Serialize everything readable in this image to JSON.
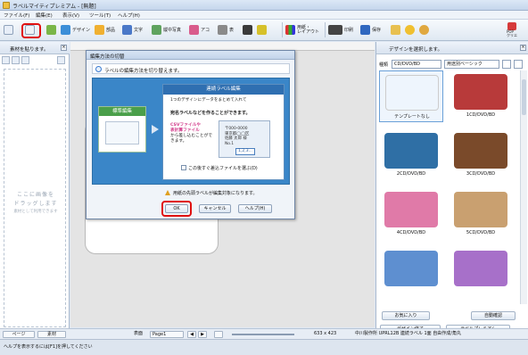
{
  "window": {
    "title": "ラベルマイティプレミアム - [無題]"
  },
  "menu": [
    "ファイル(F)",
    "編集(E)",
    "表示(V)",
    "ツール(T)",
    "ヘルプ(H)"
  ],
  "toolbar": {
    "design": "デザイン",
    "frame": "部品",
    "text": "文字",
    "clip": "縦中写真",
    "art": "アコ",
    "table": "表",
    "layout": "用紙・\nレイアウト",
    "print": "印刷",
    "save": "保存",
    "pop": "POP\nクリエ"
  },
  "left_pane": {
    "header": "素材を貼ります。",
    "drop_line1": "ここに画像を",
    "drop_line2": "ドラッグします",
    "drop_line3": "素材として利用できます"
  },
  "dialog": {
    "title": "編集方法の切替",
    "message": "ラベルの編集方法を切り替えます。",
    "standard_title": "標準編集",
    "multi_title": "連続ラベル編集",
    "multi_desc": "1つのデザインにデータをまとめて入れて",
    "multi_desc2": "宛名ラベルなどを作ることができます。",
    "csv_label": "CSVファイルや",
    "csv_label2": "表計算ファイル",
    "csv_rest": "から差し込むことができます。",
    "doc_lines": [
      "〒000-0000",
      "東京都◯◯区",
      "佐藤 太郎 様",
      "No.1"
    ],
    "seq_label": "1,2,3...",
    "checkbox_label": "この後すぐ差込ファイルを選ぶ(D)",
    "warning": "用紙の先頭ラベルが編集対象になります。",
    "ok": "OK",
    "cancel": "キャンセル",
    "help": "ヘルプ(H)"
  },
  "right_pane": {
    "header": "デザインを選択します。",
    "kind_label": "種類",
    "kind_value": "CD/DVD/BD",
    "sort_value": "用途別ベーシック",
    "thumbnails": [
      {
        "caption": "テンプレートなし",
        "color": "#ffffff"
      },
      {
        "caption": "1CD/DVD/BD",
        "color": "#b83a3a"
      },
      {
        "caption": "2CD/DVD/BD",
        "color": "#2f6fa5"
      },
      {
        "caption": "3CD/DVD/BD",
        "color": "#7a4a2a"
      },
      {
        "caption": "4CD/DVD/BD",
        "color": "#e07aa8"
      },
      {
        "caption": "5CD/DVD/BD",
        "color": "#c9a070"
      },
      {
        "caption": "",
        "color": "#5e8fd0"
      },
      {
        "caption": "",
        "color": "#a770c9"
      }
    ],
    "favorites_button": "お気に入り",
    "auto_confirm_button": "自動確認",
    "design_select_button": "デザイン終了",
    "label_premium_button": "ラベルプレミアム"
  },
  "bottom": {
    "page_tab": "ページ",
    "material_tab": "素材",
    "page_label": "表面",
    "page_value": "Page1",
    "size_readout": "633 x 423",
    "paper_info": "中川製作所 UPRL12B 連続ラベル 1面 自由作成/角丸"
  },
  "status": {
    "help_text": "ヘルプを表示するには[F1]を押してください"
  }
}
